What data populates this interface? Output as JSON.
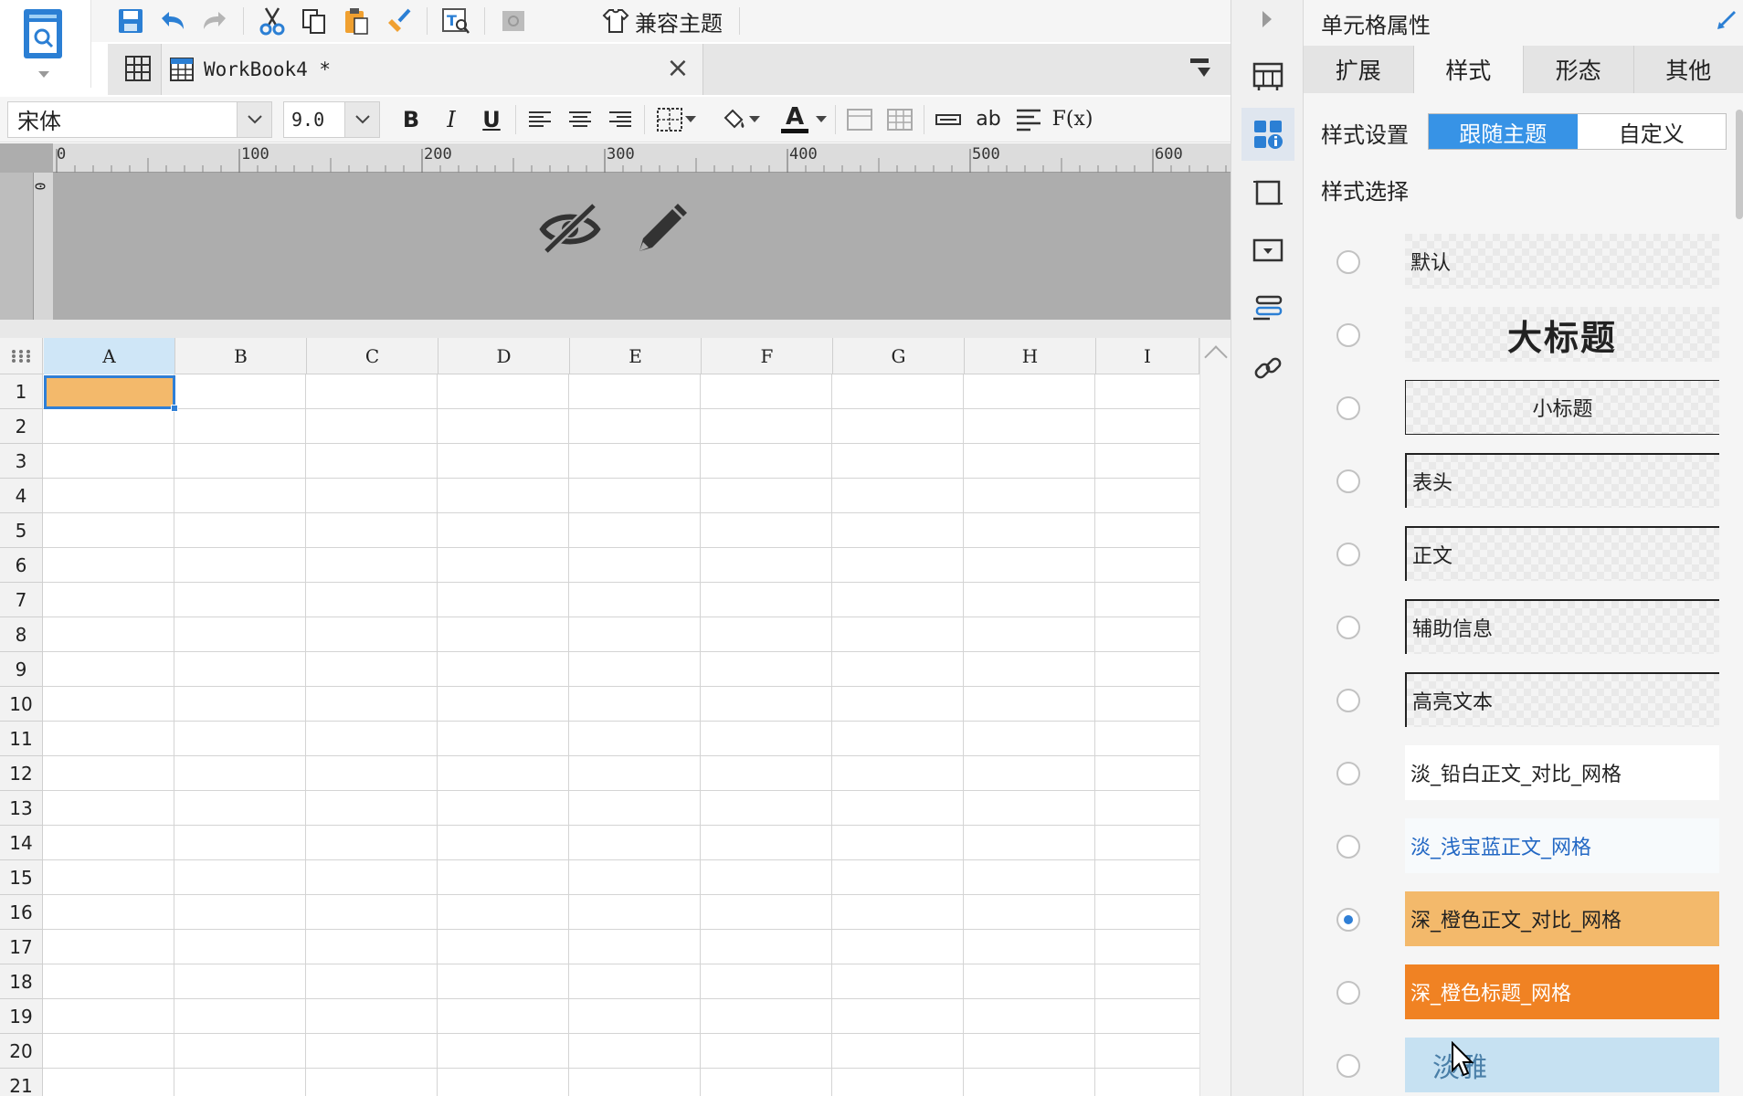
{
  "toolbar": {
    "theme_label": "兼容主题"
  },
  "tab_bar": {
    "workbook_tab_label": "WorkBook4 *",
    "close_glyph": "×"
  },
  "format_toolbar": {
    "font_value": "宋体",
    "size_value": "9.0",
    "bold_label": "B",
    "italic_label": "I",
    "underline_label": "U",
    "font_color_label": "A",
    "wrap_label": "ab",
    "formula_label": "F(x)"
  },
  "ruler": {
    "h_ticks": [
      "0",
      "100",
      "200",
      "300",
      "400",
      "500",
      "600"
    ],
    "v_first": "0"
  },
  "sheet": {
    "columns": [
      "A",
      "B",
      "C",
      "D",
      "E",
      "F",
      "G",
      "H",
      "I"
    ],
    "rows": [
      "1",
      "2",
      "3",
      "4",
      "5",
      "6",
      "7",
      "8",
      "9",
      "10",
      "11",
      "12",
      "13",
      "14",
      "15",
      "16",
      "17",
      "18",
      "19",
      "20",
      "21"
    ],
    "selected_cell": "A1",
    "selected_cell_color": "#f3b96b"
  },
  "panel": {
    "title": "单元格属性",
    "tabs": [
      "扩展",
      "样式",
      "形态",
      "其他"
    ],
    "active_tab": "样式",
    "style_setting_label": "样式设置",
    "segments": [
      "跟随主题",
      "自定义"
    ],
    "active_segment": "跟随主题",
    "style_choice_label": "样式选择",
    "styles": [
      {
        "label": "默认",
        "checked": false
      },
      {
        "label": "大标题",
        "checked": false
      },
      {
        "label": "小标题",
        "checked": false
      },
      {
        "label": "表头",
        "checked": false
      },
      {
        "label": "正文",
        "checked": false
      },
      {
        "label": "辅助信息",
        "checked": false
      },
      {
        "label": "高亮文本",
        "checked": false
      },
      {
        "label": "淡_铅白正文_对比_网格",
        "checked": false
      },
      {
        "label": "淡_浅宝蓝正文_网格",
        "checked": false
      },
      {
        "label": "深_橙色正文_对比_网格",
        "checked": true
      },
      {
        "label": "深_橙色标题_网格",
        "checked": false
      },
      {
        "label": "淡雅",
        "checked": false
      }
    ]
  },
  "colors": {
    "accent_blue": "#3793e6",
    "selection_border": "#2f7fd6",
    "orange_light": "#f3b96b",
    "orange_deep": "#f08223",
    "blue_soft": "#c6e1f2"
  }
}
